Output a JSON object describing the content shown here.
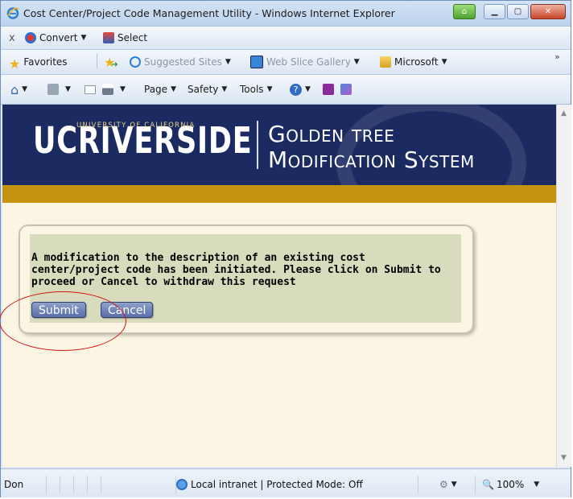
{
  "window": {
    "title": "Cost Center/Project Code Management Utility - Windows Internet Explorer",
    "buttons": [
      "minimize",
      "maximize",
      "close"
    ]
  },
  "toolbar1": {
    "close_symbol": "x",
    "convert_label": "Convert",
    "select_label": "Select"
  },
  "favorites_bar": {
    "favorites_label": "Favorites",
    "items": [
      "Suggested Sites",
      "Web Slice Gallery",
      "Microsoft"
    ],
    "overflow": "»"
  },
  "command_bar": {
    "page_label": "Page",
    "safety_label": "Safety",
    "tools_label": "Tools"
  },
  "banner": {
    "uc_text": "UCRIVERSIDE",
    "university_text": "UNIVERSITY OF CALIFORNIA",
    "title_line1": "Golden tree",
    "title_line2": "Modification System"
  },
  "form": {
    "message": "A modification to the description of an existing cost center/project code has been initiated. Please click on Submit to proceed or Cancel to withdraw this request",
    "submit_label": "Submit",
    "cancel_label": "Cancel"
  },
  "status_bar": {
    "status_text": "Don",
    "zone_text": "Local intranet | Protected Mode: Off",
    "zoom": "100%"
  },
  "colors": {
    "banner_navy": "#1b2a60",
    "gold_band": "#c6930f",
    "page_bg": "#fdf5e3",
    "panel_bg": "#d9dcbc",
    "annotation_red": "#d11515"
  }
}
